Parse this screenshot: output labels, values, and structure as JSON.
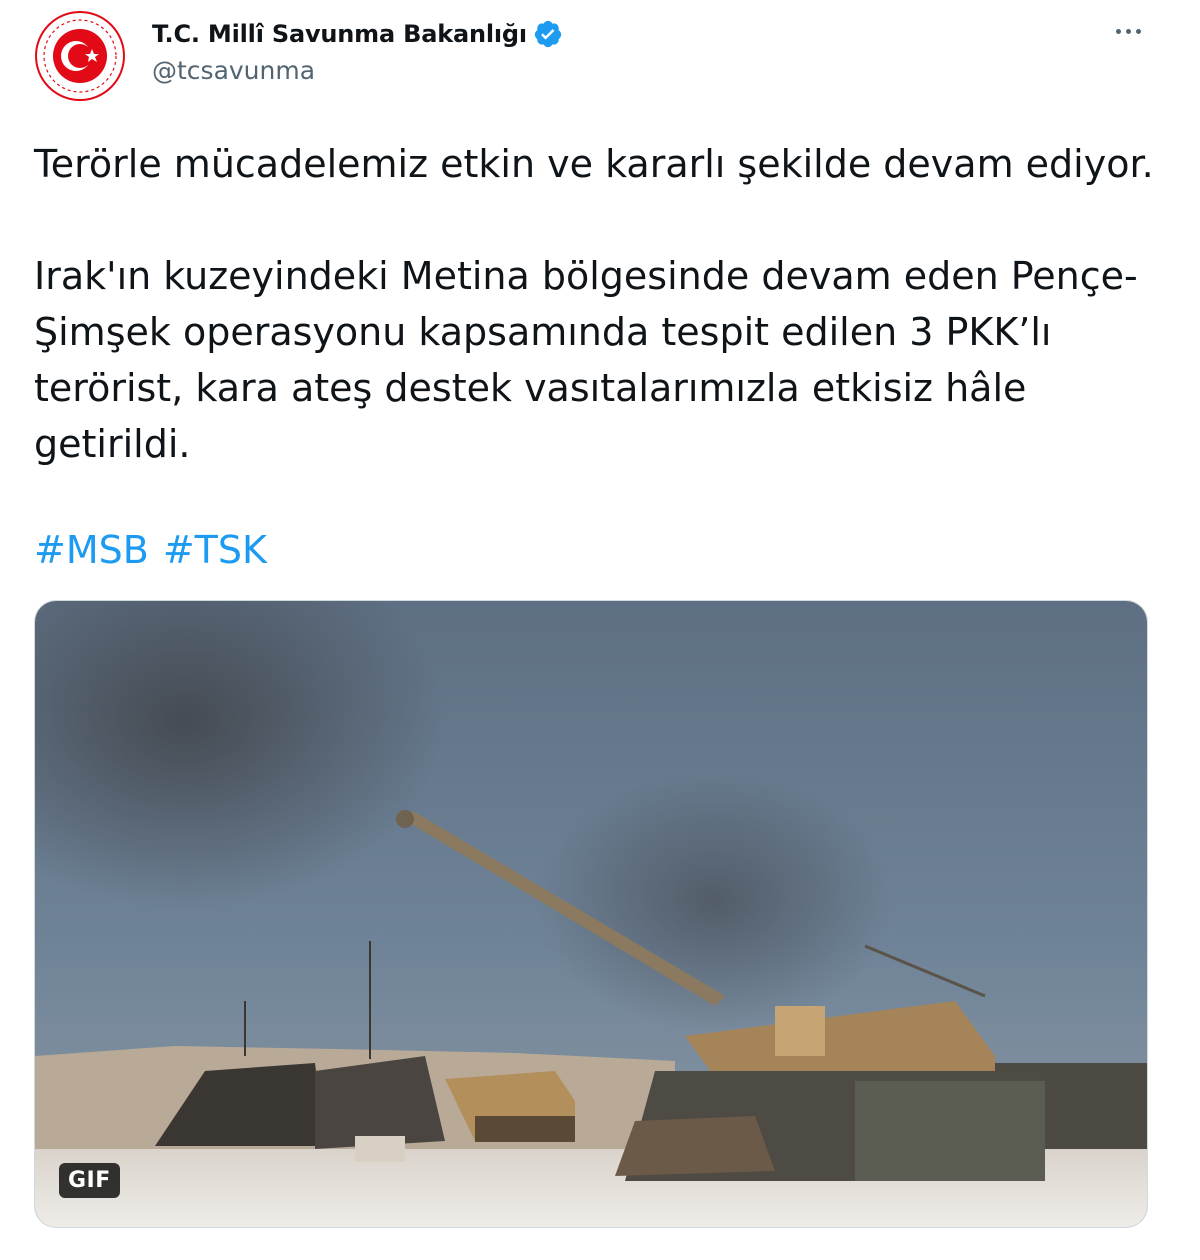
{
  "account": {
    "display_name": "T.C. Millî Savunma Bakanlığı",
    "handle": "@tcsavunma",
    "avatar_icon": "emblem-icon",
    "verified_icon": "verified-badge-icon"
  },
  "menu": {
    "more_icon": "more-horizontal-icon"
  },
  "tweet": {
    "paragraph_1": "Terörle mücadelemiz etkin ve kararlı şekilde devam ediyor.",
    "paragraph_2": "Irak'ın kuzeyindeki Metina bölgesinde devam eden Pençe-Şimşek operasyonu kapsamında tespit edilen 3 PKK’lı terörist, kara ateş destek vasıtalarımızla etkisiz hâle getirildi.",
    "hashtags": [
      "#MSB",
      "#TSK"
    ]
  },
  "media": {
    "badge": "GIF"
  },
  "colors": {
    "link": "#1d9bf0",
    "verified": "#1d9bf0",
    "emblem_red": "#e30a17",
    "secondary_text": "#536471"
  }
}
